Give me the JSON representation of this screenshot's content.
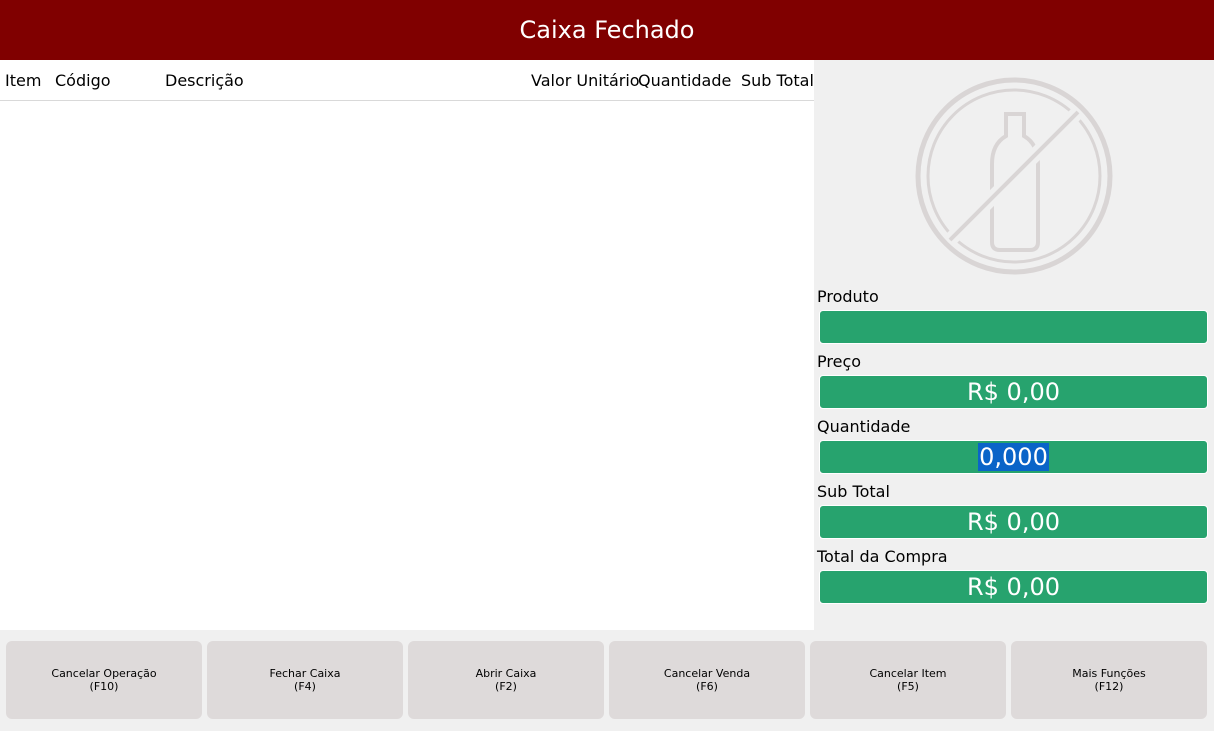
{
  "header": {
    "title": "Caixa Fechado"
  },
  "grid": {
    "columns": {
      "item": "Item",
      "codigo": "Código",
      "descricao": "Descrição",
      "valor_unitario": "Valor Unitário",
      "quantidade": "Quantidade",
      "sub_total": "Sub Total"
    }
  },
  "side": {
    "product_image_icon": "no-bottle-icon",
    "produto": {
      "label": "Produto",
      "value": ""
    },
    "preco": {
      "label": "Preço",
      "value": "R$ 0,00"
    },
    "quantidade": {
      "label": "Quantidade",
      "value": "0,000"
    },
    "sub_total": {
      "label": "Sub Total",
      "value": "R$ 0,00"
    },
    "total_compra": {
      "label": "Total da Compra",
      "value": "R$ 0,00"
    }
  },
  "toolbar": {
    "buttons": [
      {
        "label": "Cancelar Operação",
        "key": "(F10)"
      },
      {
        "label": "Fechar Caixa",
        "key": "(F4)"
      },
      {
        "label": "Abrir Caixa",
        "key": "(F2)"
      },
      {
        "label": "Cancelar Venda",
        "key": "(F6)"
      },
      {
        "label": "Cancelar Item",
        "key": "(F5)"
      },
      {
        "label": "Mais Funções",
        "key": "(F12)"
      }
    ]
  },
  "colors": {
    "header_bg": "#800000",
    "field_bg": "#27a36e",
    "selection": "#0a64c8",
    "button_bg": "#dedada"
  }
}
